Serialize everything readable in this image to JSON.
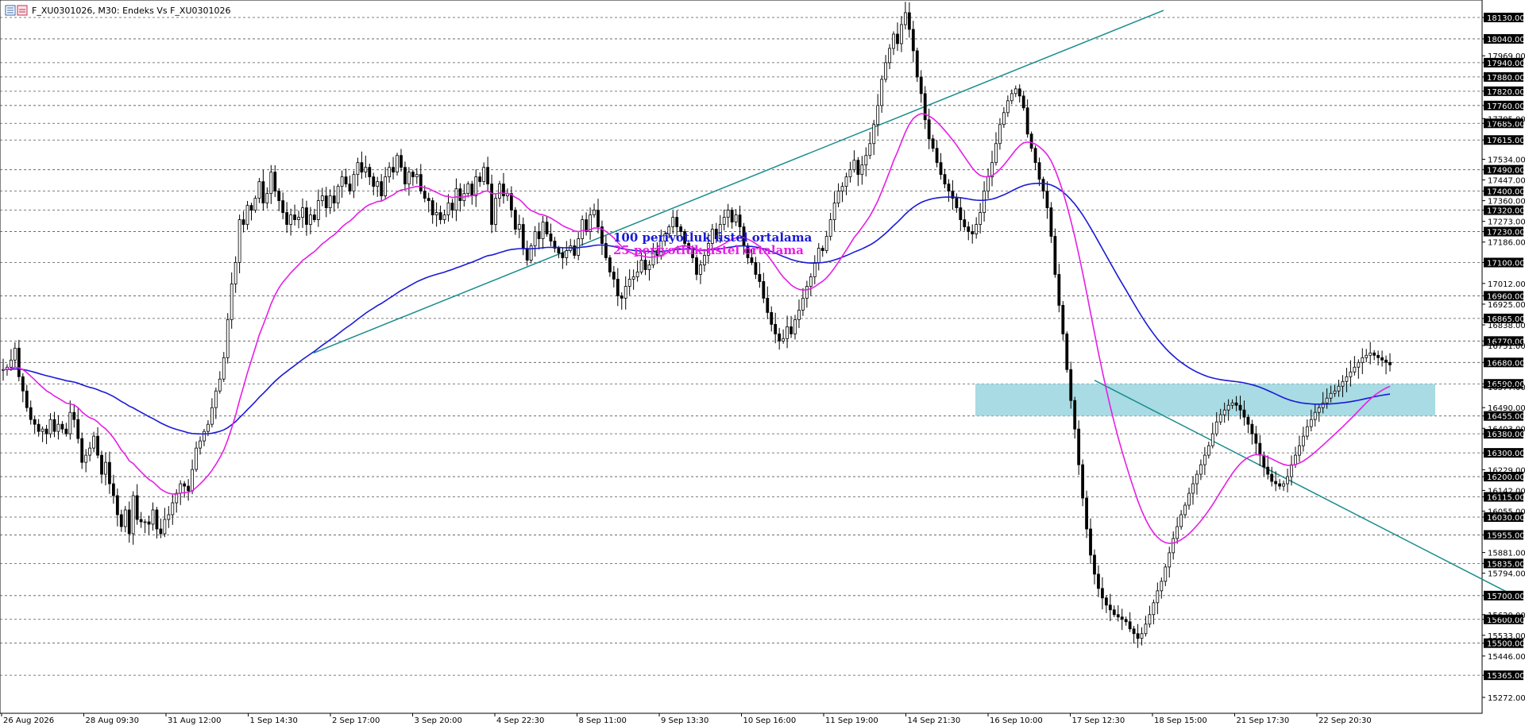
{
  "window": {
    "title": "F_XU0301026, M30:  Endeks Vs F_XU0301026"
  },
  "colors": {
    "background": "#ffffff",
    "candle": "#000000",
    "ema100": "#1a1ad6",
    "ema25": "#e61ee6",
    "trendline": "#1a8c8c",
    "zone_fill": "#a8dbe3",
    "grid": "#555555",
    "axis_label_bg": "#000000",
    "axis_label_text": "#ffffff"
  },
  "icons": [
    "chart-window-icon"
  ],
  "chart_data": {
    "type": "candlestick",
    "title": "F_XU0301026, M30:  Endeks Vs F_XU0301026",
    "grid": "horizontal-dashed",
    "ylim": [
      15230,
      18150
    ],
    "x_labels": [
      "26 Aug 2026",
      "28 Aug 09:30",
      "31 Aug 12:00",
      "1 Sep 14:30",
      "2 Sep 17:00",
      "3 Sep 20:00",
      "4 Sep 22:30",
      "8 Sep 11:00",
      "9 Sep 13:30",
      "10 Sep 16:00",
      "11 Sep 19:00",
      "14 Sep 21:30",
      "16 Sep 10:00",
      "17 Sep 12:30",
      "18 Sep 15:00",
      "21 Sep 17:30",
      "22 Sep 20:30"
    ],
    "price_levels_highlighted": [
      "18130.00",
      "18040.00",
      "17940.00",
      "17880.00",
      "17820.00",
      "17760.00",
      "17685.00",
      "17615.00",
      "17490.00",
      "17400.00",
      "17320.00",
      "17230.00",
      "17100.00",
      "16960.00",
      "16865.00",
      "16770.00",
      "16680.00",
      "16590.00",
      "16455.00",
      "16380.00",
      "16300.00",
      "16200.00",
      "16115.00",
      "16030.00",
      "15955.00",
      "15835.00",
      "15700.00",
      "15600.00",
      "15500.00",
      "15365.00"
    ],
    "price_levels_plain": [
      "17969.00",
      "17705.00",
      "17534.00",
      "17447.00",
      "17360.00",
      "17273.00",
      "17186.00",
      "17012.00",
      "16925.00",
      "16838.00",
      "16751.00",
      "16577.00",
      "16490.00",
      "16403.00",
      "16229.00",
      "16142.00",
      "16055.00",
      "15881.00",
      "15794.00",
      "15620.00",
      "15533.00",
      "15446.00",
      "15272.00"
    ],
    "close_path": [
      16650,
      16660,
      16690,
      16740,
      16620,
      16560,
      16490,
      16440,
      16420,
      16390,
      16400,
      16380,
      16440,
      16390,
      16420,
      16400,
      16380,
      16470,
      16440,
      16360,
      16260,
      16290,
      16320,
      16370,
      16290,
      16210,
      16260,
      16170,
      16120,
      16040,
      15990,
      16060,
      15960,
      16120,
      16020,
      16010,
      16010,
      16000,
      16060,
      15980,
      15960,
      16020,
      16040,
      16090,
      16130,
      16170,
      16160,
      16140,
      16230,
      16320,
      16350,
      16390,
      16420,
      16490,
      16560,
      16610,
      16700,
      16860,
      17010,
      17100,
      17280,
      17260,
      17340,
      17320,
      17370,
      17440,
      17350,
      17390,
      17480,
      17400,
      17360,
      17310,
      17260,
      17300,
      17280,
      17290,
      17330,
      17260,
      17300,
      17280,
      17360,
      17380,
      17330,
      17380,
      17350,
      17420,
      17460,
      17430,
      17400,
      17470,
      17520,
      17480,
      17500,
      17460,
      17420,
      17440,
      17380,
      17460,
      17500,
      17480,
      17550,
      17500,
      17430,
      17480,
      17460,
      17470,
      17400,
      17370,
      17360,
      17300,
      17310,
      17280,
      17300,
      17350,
      17320,
      17410,
      17360,
      17390,
      17430,
      17380,
      17460,
      17440,
      17500,
      17430,
      17260,
      17370,
      17430,
      17380,
      17390,
      17320,
      17240,
      17260,
      17160,
      17110,
      17170,
      17230,
      17200,
      17270,
      17220,
      17190,
      17160,
      17140,
      17120,
      17150,
      17170,
      17130,
      17200,
      17280,
      17230,
      17300,
      17320,
      17250,
      17180,
      17120,
      17060,
      17030,
      16960,
      16950,
      17000,
      17030,
      17040,
      17060,
      17110,
      17070,
      17090,
      17150,
      17130,
      17190,
      17220,
      17250,
      17290,
      17250,
      17230,
      17180,
      17160,
      17120,
      17050,
      17090,
      17130,
      17180,
      17240,
      17200,
      17260,
      17290,
      17320,
      17270,
      17300,
      17250,
      17170,
      17120,
      17100,
      17050,
      17020,
      16950,
      16890,
      16840,
      16800,
      16770,
      16780,
      16830,
      16800,
      16860,
      16900,
      16950,
      17000,
      17040,
      17100,
      17160,
      17150,
      17210,
      17280,
      17350,
      17400,
      17420,
      17460,
      17490,
      17530,
      17470,
      17510,
      17550,
      17600,
      17680,
      17760,
      17870,
      17940,
      18000,
      18060,
      18020,
      18100,
      18150,
      18080,
      17990,
      17880,
      17810,
      17700,
      17620,
      17580,
      17520,
      17470,
      17430,
      17400,
      17370,
      17330,
      17280,
      17250,
      17230,
      17220,
      17260,
      17310,
      17400,
      17460,
      17520,
      17600,
      17680,
      17730,
      17780,
      17810,
      17830,
      17800,
      17750,
      17640,
      17580,
      17520,
      17450,
      17400,
      17330,
      17210,
      17050,
      16920,
      16800,
      16650,
      16520,
      16400,
      16250,
      16110,
      15980,
      15870,
      15790,
      15730,
      15690,
      15660,
      15640,
      15620,
      15610,
      15600,
      15590,
      15560,
      15540,
      15520,
      15540,
      15580,
      15620,
      15670,
      15720,
      15760,
      15820,
      15880,
      15940,
      15990,
      16040,
      16080,
      16130,
      16170,
      16210,
      16250,
      16290,
      16330,
      16380,
      16430,
      16460,
      16480,
      16500,
      16510,
      16500,
      16480,
      16450,
      16420,
      16380,
      16340,
      16290,
      16240,
      16210,
      16180,
      16170,
      16160,
      16170,
      16200,
      16250,
      16290,
      16330,
      16370,
      16410,
      16440,
      16470,
      16490,
      16510,
      16530,
      16550,
      16560,
      16580,
      16600,
      16620,
      16640,
      16660,
      16680,
      16700,
      16710,
      16720,
      16710,
      16700,
      16690,
      16680,
      16670
    ]
  }
}
